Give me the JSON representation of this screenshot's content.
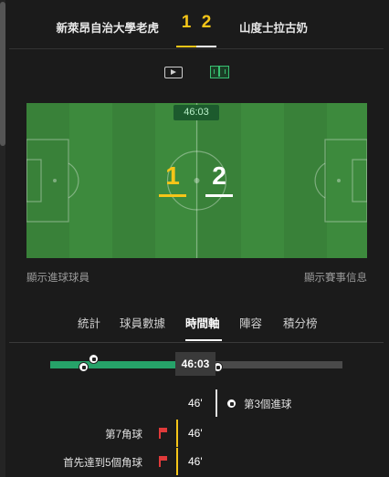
{
  "header": {
    "home_team": "新萊昂自治大學老虎",
    "away_team": "山度士拉古奶",
    "home_score": "1",
    "away_score": "2"
  },
  "media_icons": [
    "video-icon",
    "pitch-icon"
  ],
  "pitch": {
    "minute": "46:03",
    "home_score": "1",
    "away_score": "2"
  },
  "links": {
    "show_scorers": "顯示進球球員",
    "show_match_info": "顯示賽事信息"
  },
  "tabs": [
    {
      "label": "統計"
    },
    {
      "label": "球員數據"
    },
    {
      "label": "時間軸"
    },
    {
      "label": "陣容"
    },
    {
      "label": "積分榜"
    }
  ],
  "active_tab": "時間軸",
  "timeline": {
    "current": "46:03",
    "progress_fraction": 0.51
  },
  "events": [
    {
      "minute": "46'",
      "text": "第3個進球",
      "side": "away",
      "icon": "ball-icon"
    },
    {
      "minute": "46'",
      "text": "第7角球",
      "side": "home",
      "icon": "corner-flag-icon"
    },
    {
      "minute": "46'",
      "text": "首先達到5個角球",
      "side": "home",
      "icon": "corner-flag-icon"
    }
  ],
  "colors": {
    "home": "#f5c518",
    "away": "#ffffff",
    "pitch": "#3d8a3d",
    "accent": "#26a269"
  }
}
